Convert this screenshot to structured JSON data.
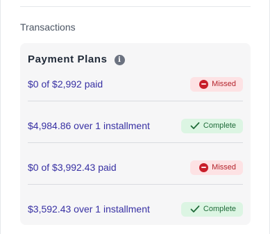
{
  "section": {
    "label": "Transactions"
  },
  "payment_plans": {
    "title": "Payment Plans",
    "info_icon": "info-icon",
    "rows": [
      {
        "text": "$0 of $2,992 paid",
        "status": "Missed",
        "status_icon": "stop-icon"
      },
      {
        "text": "$4,984.86 over 1 installment",
        "status": "Complete",
        "status_icon": "check-icon"
      },
      {
        "text": "$0 of $3,992.43 paid",
        "status": "Missed",
        "status_icon": "stop-icon"
      },
      {
        "text": "$3,592.43 over 1 installment",
        "status": "Complete",
        "status_icon": "check-icon"
      }
    ]
  },
  "colors": {
    "link": "#3730a3",
    "missed_bg": "#fde2e4",
    "missed_text": "#b4232c",
    "complete_bg": "#dcf5e3",
    "complete_text": "#1f6b39"
  }
}
